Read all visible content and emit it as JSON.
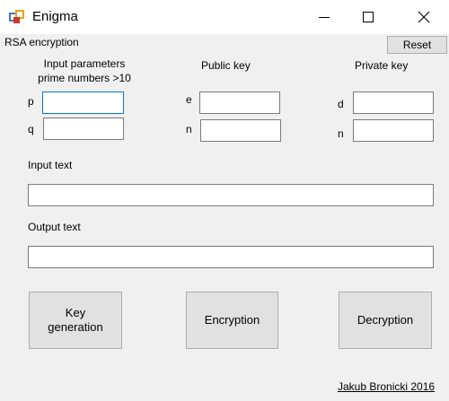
{
  "window": {
    "title": "Enigma",
    "icon": "enigma-app-icon",
    "controls": [
      "minimize-icon",
      "maximize-icon",
      "close-icon"
    ]
  },
  "form": {
    "heading": "RSA encryption",
    "reset_label": "Reset",
    "input_params": {
      "title_line1": "Input parameters",
      "title_line2": "prime numbers >10",
      "p_label": "p",
      "q_label": "q",
      "p_value": "",
      "q_value": ""
    },
    "public_key": {
      "title": "Public key",
      "e_label": "e",
      "n_label": "n",
      "e_value": "",
      "n_value": ""
    },
    "private_key": {
      "title": "Private key",
      "d_label": "d",
      "n_label": "n",
      "d_value": "",
      "n_value": ""
    },
    "input_text": {
      "label": "Input text",
      "value": ""
    },
    "output_text": {
      "label": "Output text",
      "value": ""
    },
    "buttons": {
      "key_gen_line1": "Key",
      "key_gen_line2": "generation",
      "encryption": "Encryption",
      "decryption": "Decryption"
    },
    "footer": "Jakub Bronicki 2016"
  },
  "colors": {
    "window_bg": "#f0f0f0",
    "titlebar_bg": "#ffffff",
    "focus_border": "#0078d7",
    "button_bg": "#e1e1e1"
  }
}
